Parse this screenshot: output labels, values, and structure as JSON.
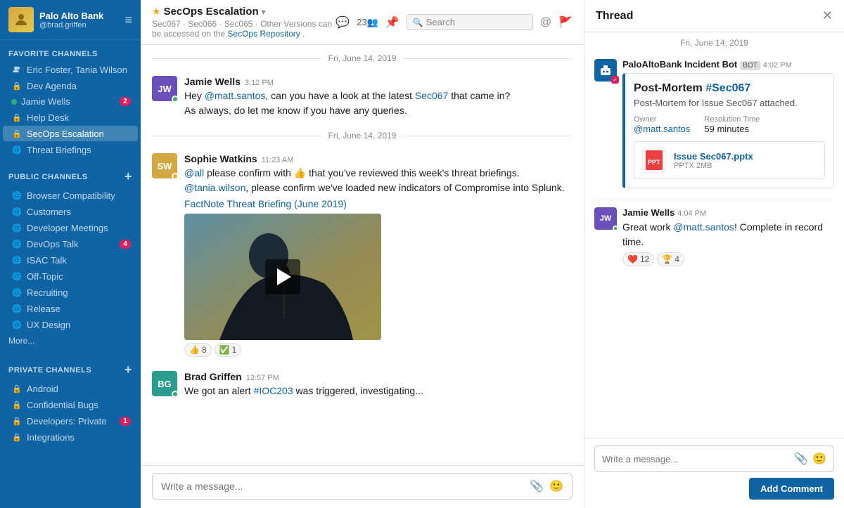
{
  "app": {
    "workspace": "Palo Alto Bank",
    "username": "@brad.griffen"
  },
  "sidebar": {
    "menu_icon": "≡",
    "favorite_section": "FAVORITE CHANNELS",
    "public_section": "PUBLIC CHANNELS",
    "private_section": "PRIVATE CHANNELS",
    "favorite_channels": [
      {
        "id": "eric-tania",
        "label": "Eric Foster, Tania Wilson",
        "icon": "person",
        "type": "dm"
      },
      {
        "id": "dev-agenda",
        "label": "Dev Agenda",
        "icon": "lock",
        "type": "private"
      },
      {
        "id": "jamie-wells",
        "label": "Jamie Wells",
        "icon": "person",
        "type": "dm",
        "badge": "2",
        "dot": "online"
      },
      {
        "id": "help-desk",
        "label": "Help Desk",
        "icon": "lock",
        "type": "private"
      },
      {
        "id": "secops-escalation",
        "label": "SecOps Escalation",
        "icon": "lock",
        "type": "private",
        "active": true
      },
      {
        "id": "threat-briefings",
        "label": "Threat Briefings",
        "icon": "globe",
        "type": "public"
      }
    ],
    "public_channels": [
      {
        "id": "browser-compat",
        "label": "Browser Compatibility",
        "icon": "globe"
      },
      {
        "id": "customers",
        "label": "Customers",
        "icon": "globe"
      },
      {
        "id": "developer-meetings",
        "label": "Developer Meetings",
        "icon": "globe"
      },
      {
        "id": "devops-talk",
        "label": "DevOps Talk",
        "icon": "globe",
        "badge": "4"
      },
      {
        "id": "isac-talk",
        "label": "ISAC Talk",
        "icon": "globe"
      },
      {
        "id": "off-topic",
        "label": "Off-Topic",
        "icon": "globe"
      },
      {
        "id": "recruiting",
        "label": "Recruiting",
        "icon": "globe"
      },
      {
        "id": "release",
        "label": "Release",
        "icon": "globe"
      },
      {
        "id": "ux-design",
        "label": "UX Design",
        "icon": "globe"
      }
    ],
    "more_label": "More...",
    "private_channels": [
      {
        "id": "android",
        "label": "Android",
        "icon": "lock"
      },
      {
        "id": "confidential-bugs",
        "label": "Confidential Bugs",
        "icon": "lock"
      },
      {
        "id": "developers-private",
        "label": "Developers: Private",
        "icon": "lock",
        "badge": "1"
      },
      {
        "id": "integrations",
        "label": "Integrations",
        "icon": "lock"
      }
    ]
  },
  "channel": {
    "star": "★",
    "name": "SecOps Escalation",
    "chevron": "▾",
    "desc_text": "Sec067 · Sec066 · Sec065 · Other Versions can be accessed on the",
    "desc_link_text": "SecOps Repository",
    "members_count": "23",
    "members_icon": "👥",
    "search_placeholder": "Search"
  },
  "messages": [
    {
      "id": "msg1",
      "date_divider": "Fri, June 14, 2019",
      "author": "Jamie Wells",
      "avatar_color": "#6b4fbb",
      "avatar_initials": "JW",
      "time": "3:12 PM",
      "status": "online",
      "text_parts": [
        {
          "type": "text",
          "content": "Hey "
        },
        {
          "type": "mention",
          "content": "@matt.santos"
        },
        {
          "type": "text",
          "content": ", can you have a look at the latest "
        },
        {
          "type": "link",
          "content": "Sec067"
        },
        {
          "type": "text",
          "content": " that came in?"
        }
      ],
      "text2": "As always, do let me know if you have any queries."
    },
    {
      "id": "msg2",
      "date_divider": "Fri, June 14, 2019",
      "author": "Sophie Watkins",
      "avatar_color": "#d4a843",
      "avatar_initials": "SW",
      "time": "11:23 AM",
      "status": "away",
      "text1": "@all please confirm with 👍 that you've reviewed this week's threat briefings.",
      "text2_parts": [
        {
          "type": "mention",
          "content": "@tania.wilson"
        },
        {
          "type": "text",
          "content": ", please confirm we've loaded new indicators of Compromise into Splunk."
        }
      ],
      "link": "FactNote Threat Briefing (June 2019)",
      "has_video": true,
      "reactions": [
        {
          "emoji": "👍",
          "count": "8"
        },
        {
          "emoji": "✅",
          "count": "1"
        }
      ]
    },
    {
      "id": "msg3",
      "author": "Brad Griffen",
      "avatar_color": "#2a9d8f",
      "avatar_initials": "BG",
      "time": "12:57 PM",
      "status": "online",
      "text_parts": [
        {
          "type": "text",
          "content": "We got an alert "
        },
        {
          "type": "link",
          "content": "#IOC203"
        },
        {
          "type": "text",
          "content": " was triggered, investigating..."
        }
      ]
    }
  ],
  "message_input": {
    "placeholder": "Write a message...",
    "attach_icon": "📎",
    "emoji_icon": "🙂"
  },
  "thread": {
    "title": "Thread",
    "close_icon": "✕",
    "date": "Fri, June 14, 2019",
    "messages": [
      {
        "id": "t1",
        "author": "PaloAltoBank Incident Bot",
        "bot_label": "BOT",
        "time": "4:02 PM",
        "card": {
          "title": "Post-Mortem",
          "issue": "#Sec067",
          "desc": "Post-Mortem for Issue Sec067 attached.",
          "owner_label": "Owner",
          "owner_value": "@matt.santos",
          "resolution_label": "Resolution Time",
          "resolution_value": "59 minutes",
          "file_name": "Issue Sec067.pptx",
          "file_size": "PPTX 2MB"
        }
      },
      {
        "id": "t2",
        "author": "Jamie Wells",
        "avatar_color": "#6b4fbb",
        "avatar_initials": "JW",
        "time": "4:04 PM",
        "status": "online",
        "text_parts": [
          {
            "type": "text",
            "content": "Great work "
          },
          {
            "type": "mention",
            "content": "@matt.santos"
          },
          {
            "type": "text",
            "content": "! Complete in record time."
          }
        ],
        "reactions": [
          {
            "emoji": "❤️",
            "count": "12"
          },
          {
            "emoji": "🏆",
            "count": "4"
          }
        ]
      }
    ],
    "input_placeholder": "Write a message...",
    "add_comment_label": "Add Comment"
  }
}
